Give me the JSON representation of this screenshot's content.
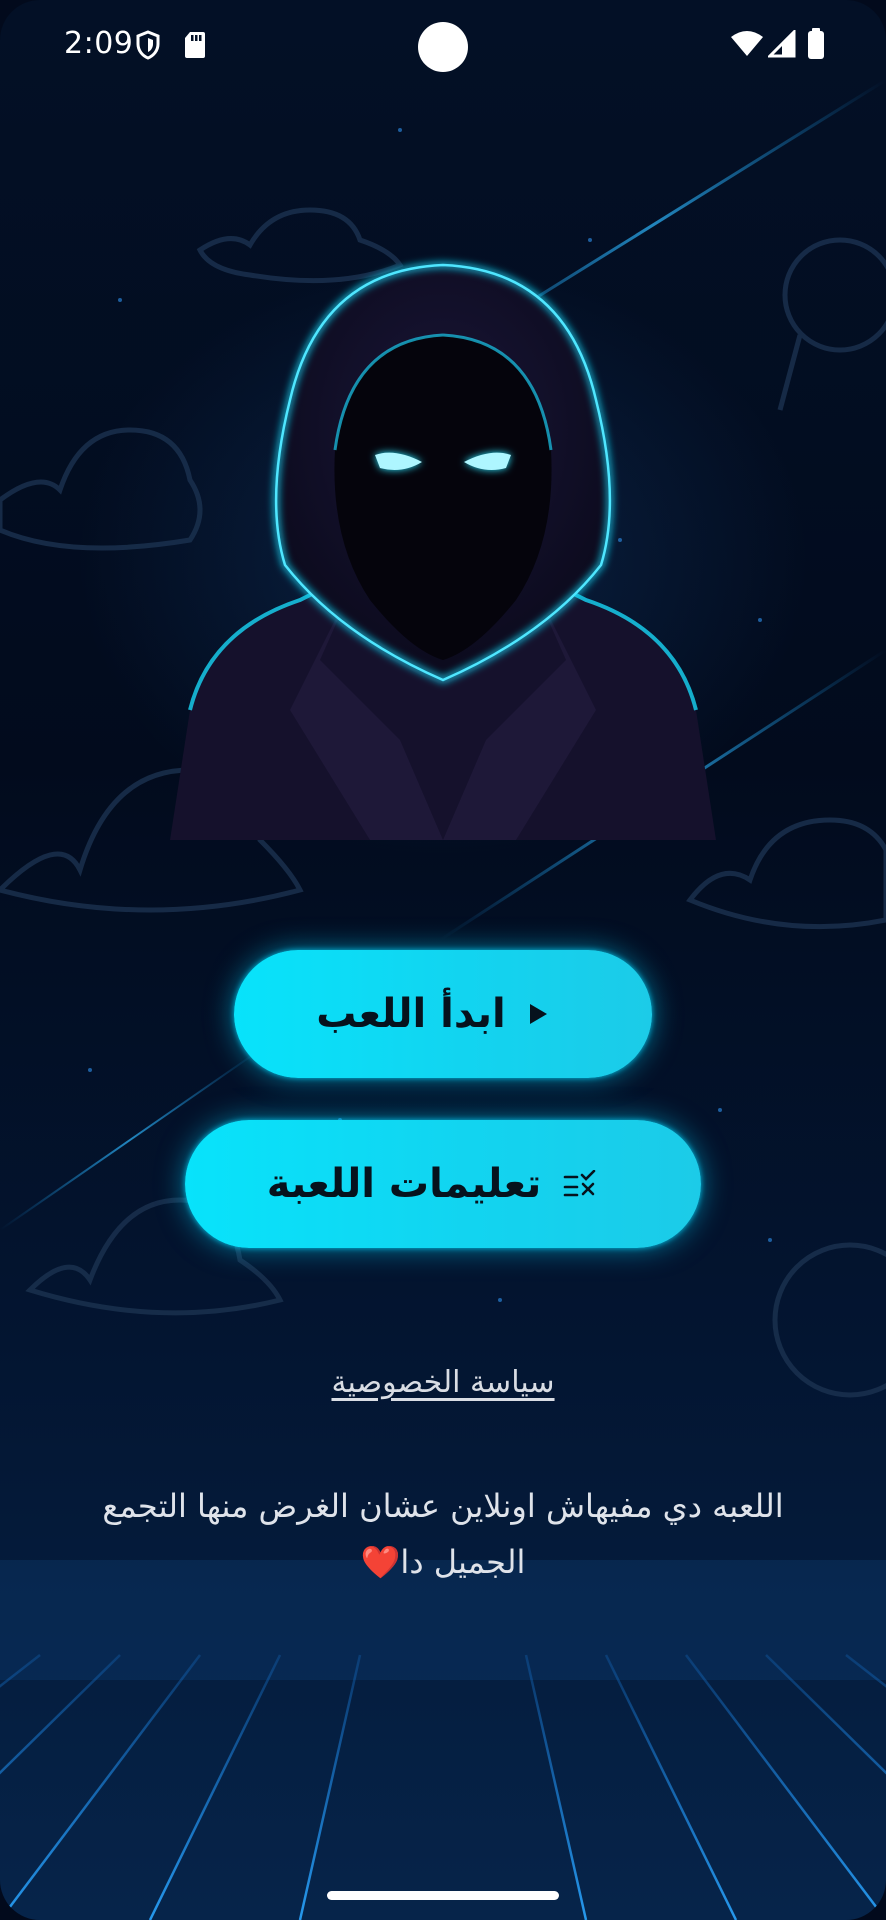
{
  "status_bar": {
    "time": "2:09",
    "left_icons": [
      "shield-icon",
      "sd-card-icon"
    ],
    "right_icons": [
      "wifi-icon",
      "signal-icon",
      "battery-icon"
    ]
  },
  "hero": {
    "icon": "hooded-spy-illustration"
  },
  "buttons": {
    "play": {
      "label": "ابدأ اللعب",
      "icon": "play-icon"
    },
    "rules": {
      "label": "تعليمات اللعبة",
      "icon": "checklist-icon"
    }
  },
  "privacy_link": "سياسة الخصوصية",
  "note": {
    "line1": "اللعبه دي مفيهاش اونلاين عشان الغرض منها التجمع",
    "line2": "الجميل دا",
    "heart": "❤️"
  },
  "colors": {
    "accent": "#08e3fb",
    "background": "#020a1c",
    "neon": "#1ad6ff"
  }
}
